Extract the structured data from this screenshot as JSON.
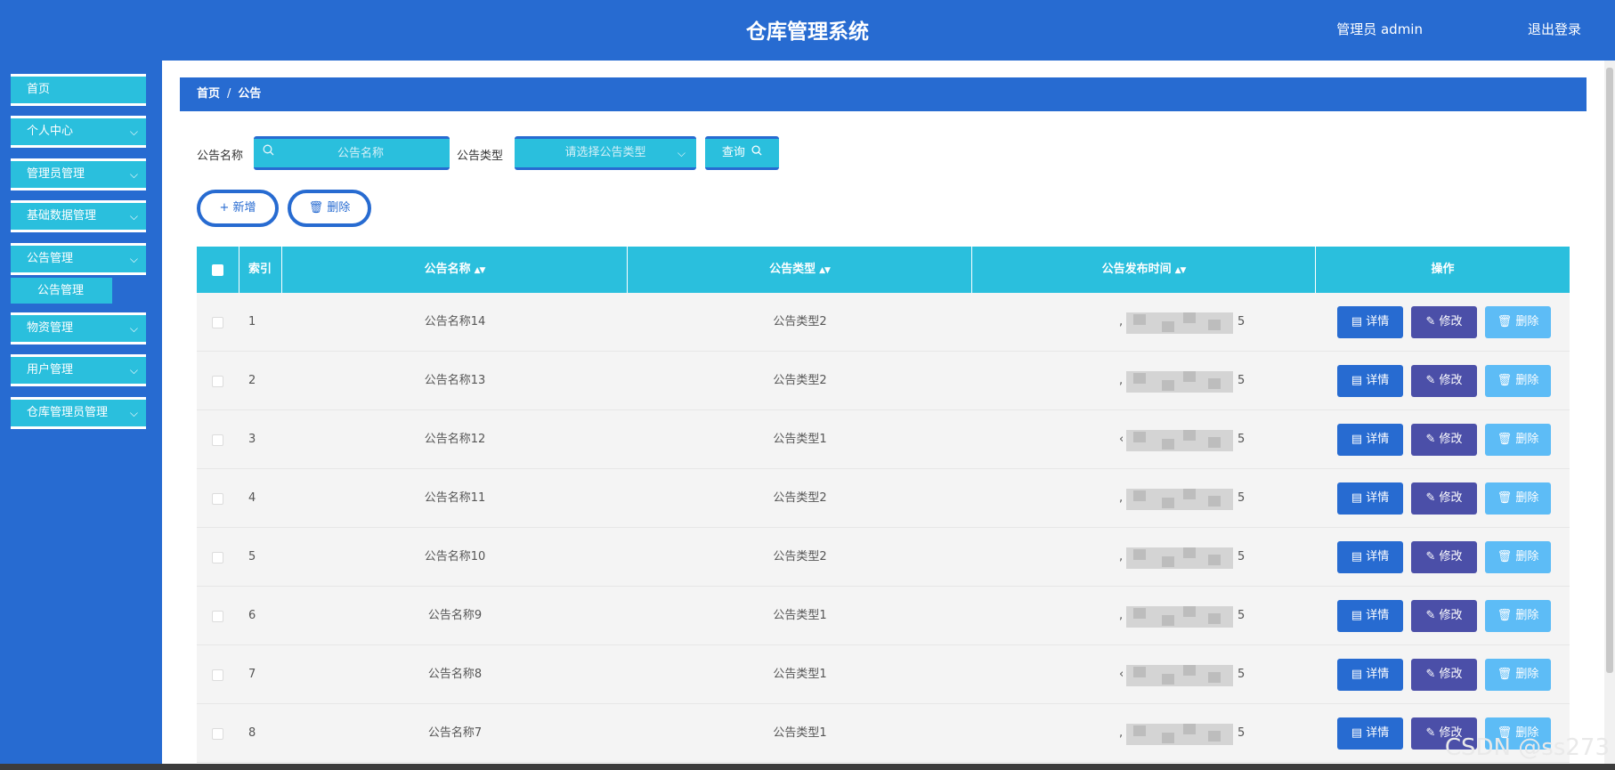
{
  "header": {
    "title": "仓库管理系统",
    "user": "管理员 admin",
    "logout": "退出登录"
  },
  "sidebar": {
    "items": [
      {
        "label": "首页"
      },
      {
        "label": "个人中心",
        "chevron": "⌵"
      },
      {
        "label": "管理员管理",
        "chevron": "⌵"
      },
      {
        "label": "基础数据管理",
        "chevron": "⌵"
      },
      {
        "label": "公告管理",
        "chevron": "⌵"
      },
      {
        "label": "物资管理",
        "chevron": "⌵"
      },
      {
        "label": "用户管理",
        "chevron": "⌵"
      },
      {
        "label": "仓库管理员管理",
        "chevron": "⌵"
      }
    ],
    "submenu": {
      "label": "公告管理"
    }
  },
  "breadcrumb": {
    "home": "首页",
    "separator": "/",
    "current": "公告"
  },
  "search": {
    "name_label": "公告名称",
    "name_placeholder": "公告名称",
    "name_icon": "search-icon",
    "type_label": "公告类型",
    "type_placeholder": "请选择公告类型",
    "query_label": "查询"
  },
  "actions": {
    "add_label": "新增",
    "add_icon": "plus-icon",
    "delete_label": "删除",
    "delete_icon": "trash-icon"
  },
  "table": {
    "headers": {
      "index": "索引",
      "name": "公告名称",
      "type": "公告类型",
      "time": "公告发布时间",
      "ops": "操作"
    },
    "rows": [
      {
        "index": "1",
        "name": "公告名称14",
        "type": "公告类型2",
        "time_prefix": ",",
        "time_suffix": "5"
      },
      {
        "index": "2",
        "name": "公告名称13",
        "type": "公告类型2",
        "time_prefix": ",",
        "time_suffix": "5"
      },
      {
        "index": "3",
        "name": "公告名称12",
        "type": "公告类型1",
        "time_prefix": "‹",
        "time_suffix": "5"
      },
      {
        "index": "4",
        "name": "公告名称11",
        "type": "公告类型2",
        "time_prefix": ",",
        "time_suffix": "5"
      },
      {
        "index": "5",
        "name": "公告名称10",
        "type": "公告类型2",
        "time_prefix": ",",
        "time_suffix": "5"
      },
      {
        "index": "6",
        "name": "公告名称9",
        "type": "公告类型1",
        "time_prefix": ",",
        "time_suffix": "5"
      },
      {
        "index": "7",
        "name": "公告名称8",
        "type": "公告类型1",
        "time_prefix": "‹",
        "time_suffix": "5"
      },
      {
        "index": "8",
        "name": "公告名称7",
        "type": "公告类型1",
        "time_prefix": ",",
        "time_suffix": "5"
      }
    ],
    "row_buttons": {
      "detail": "详情",
      "edit": "修改",
      "delete": "删除"
    }
  },
  "watermark": "CSDN @ss273",
  "colors": {
    "primary": "#276bd1",
    "cyan": "#2abfdd",
    "edit": "#4b4fa8",
    "delete": "#5dbcf6"
  }
}
